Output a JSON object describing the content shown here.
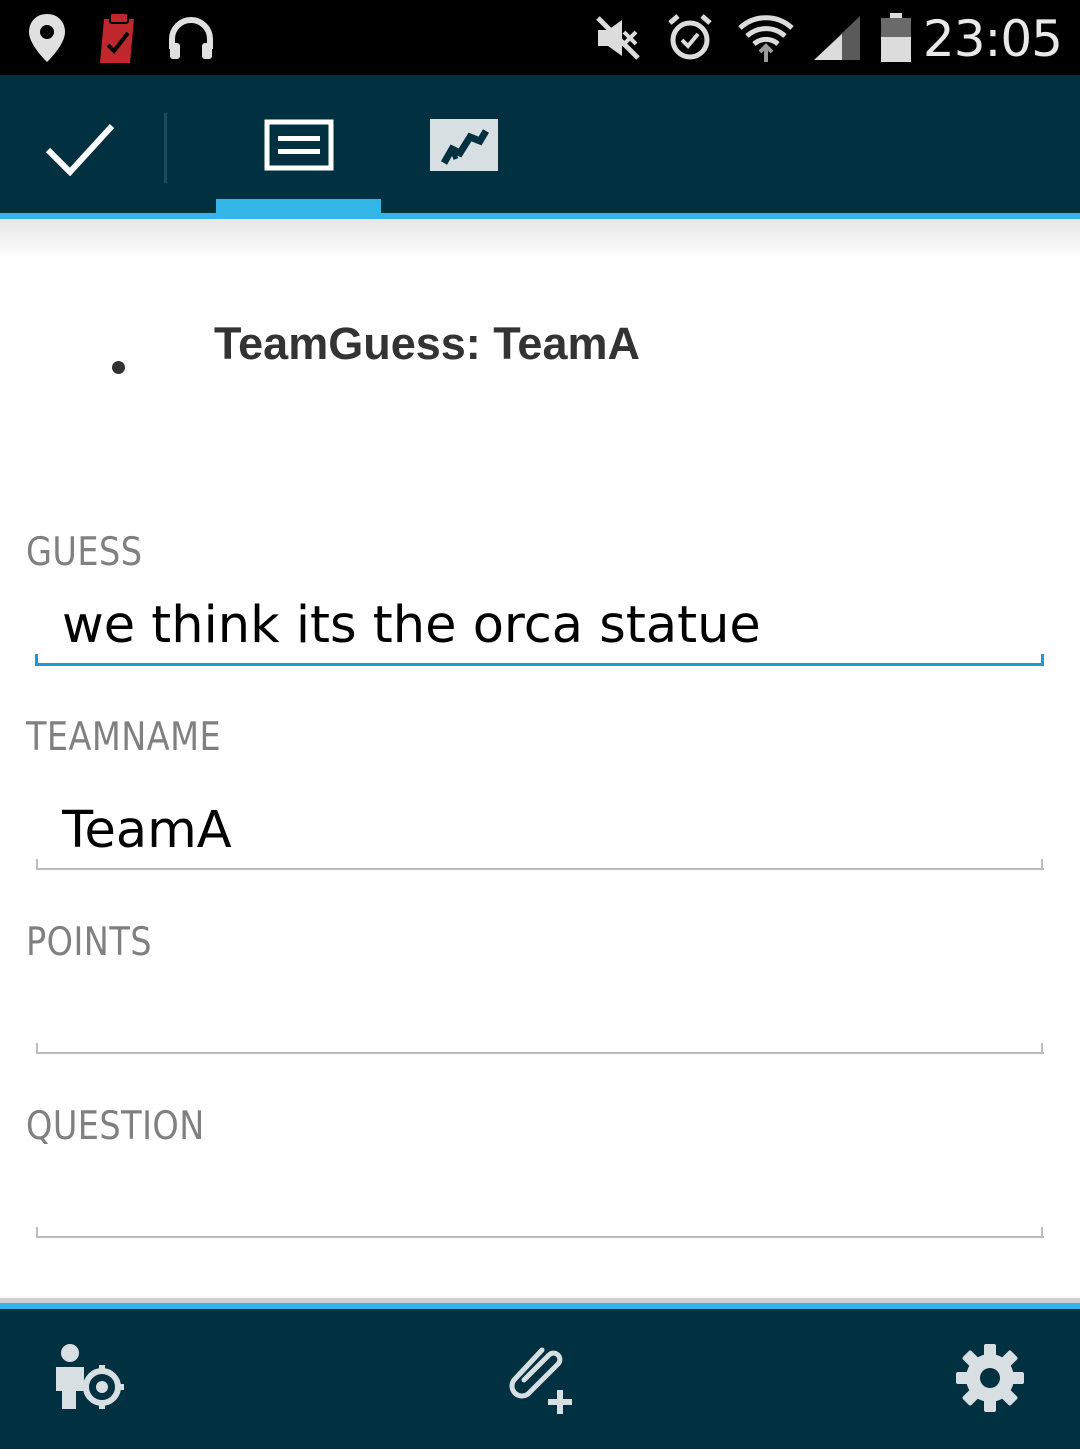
{
  "status_bar": {
    "time": "23:05",
    "left_icons": [
      "location-pin-icon",
      "clipboard-icon",
      "headset-icon"
    ],
    "right_icons": [
      "mute-icon",
      "alarm-icon",
      "wifi-icon",
      "signal-icon",
      "battery-icon"
    ]
  },
  "action_bar": {
    "confirm_icon": "check-icon",
    "tabs": [
      {
        "name": "form-tab",
        "icon": "form-icon",
        "selected": true
      },
      {
        "name": "map-tab",
        "icon": "map-icon",
        "selected": false
      }
    ],
    "accent": "#33b5e5",
    "background": "#013040"
  },
  "record": {
    "title": "TeamGuess: TeamA"
  },
  "fields": {
    "guess": {
      "label": "GUESS",
      "value": "we think its the orca statue"
    },
    "teamname": {
      "label": "TEAMNAME",
      "value": "TeamA"
    },
    "points": {
      "label": "POINTS",
      "value": ""
    },
    "question": {
      "label": "QUESTION",
      "value": ""
    }
  },
  "bottom_bar": {
    "buttons": [
      "locate-user-icon",
      "attach-add-icon",
      "settings-gear-icon"
    ]
  }
}
